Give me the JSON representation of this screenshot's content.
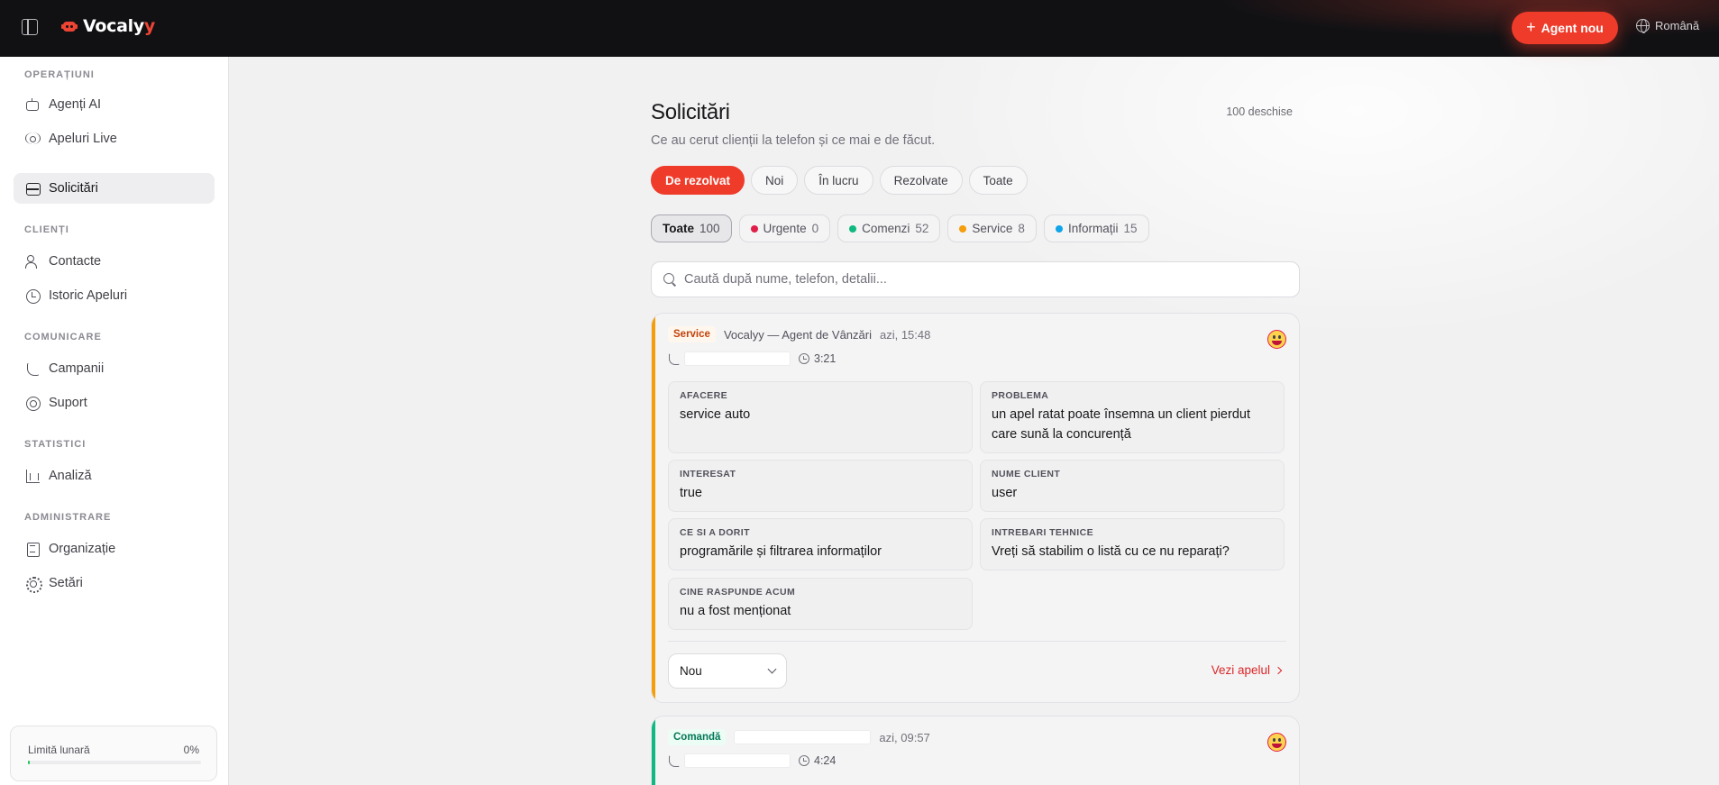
{
  "app": {
    "brand_main": "Vocaly",
    "brand_accent": "y",
    "new_agent_label": "Agent nou",
    "language": "Română",
    "colors": {
      "brand": "#ef4434",
      "sidebar_active": "#eeeef0"
    }
  },
  "sidebar": {
    "sections": [
      {
        "title": "OPERAȚIUNI",
        "items": [
          {
            "label": "Agenți AI",
            "icon": "robot-icon"
          },
          {
            "label": "Apeluri Live",
            "icon": "radio-icon"
          },
          {
            "label": "Solicitări",
            "icon": "inbox-icon",
            "active": true
          }
        ]
      },
      {
        "title": "CLIENȚI",
        "items": [
          {
            "label": "Contacte",
            "icon": "users-icon"
          },
          {
            "label": "Istoric Apeluri",
            "icon": "clock-icon"
          }
        ]
      },
      {
        "title": "COMUNICARE",
        "items": [
          {
            "label": "Campanii",
            "icon": "phone-outgoing-icon"
          },
          {
            "label": "Suport",
            "icon": "lifebuoy-icon"
          }
        ]
      },
      {
        "title": "STATISTICI",
        "items": [
          {
            "label": "Analiză",
            "icon": "bar-chart-icon"
          }
        ]
      },
      {
        "title": "ADMINISTRARE",
        "items": [
          {
            "label": "Organizație",
            "icon": "building-icon"
          },
          {
            "label": "Setări",
            "icon": "gear-icon"
          }
        ]
      }
    ],
    "limit": {
      "label": "Limită lunară",
      "value": "0%",
      "fraction": 0.0
    }
  },
  "page": {
    "title": "Solicitări",
    "subtitle": "Ce au cerut clienții la telefon și ce mai e de făcut.",
    "open_count": "100 deschise",
    "status_tabs": [
      {
        "label": "De rezolvat",
        "active": true
      },
      {
        "label": "Noi"
      },
      {
        "label": "În lucru"
      },
      {
        "label": "Rezolvate"
      },
      {
        "label": "Toate"
      }
    ],
    "category_tabs": [
      {
        "label": "Toate",
        "count": "100",
        "active": true,
        "color": ""
      },
      {
        "label": "Urgente",
        "count": "0",
        "color": "#e11d48"
      },
      {
        "label": "Comenzi",
        "count": "52",
        "color": "#10b981"
      },
      {
        "label": "Service",
        "count": "8",
        "color": "#f59e0b"
      },
      {
        "label": "Informații",
        "count": "15",
        "color": "#0ea5e9"
      }
    ],
    "search_placeholder": "Caută după nume, telefon, detalii..."
  },
  "cards": [
    {
      "category": "Service",
      "agent": "Vocalyy — Agent de Vânzări",
      "time": "azi, 15:48",
      "duration": "3:21",
      "fields": [
        {
          "label": "AFACERE",
          "value": "service auto"
        },
        {
          "label": "PROBLEMA",
          "value": "un apel ratat poate însemna un client pierdut care sună la concurență"
        },
        {
          "label": "INTERESAT",
          "value": "true"
        },
        {
          "label": "NUME CLIENT",
          "value": "user"
        },
        {
          "label": "CE SI A DORIT",
          "value": "programările și filtrarea informaților"
        },
        {
          "label": "INTREBARI TEHNICE",
          "value": "Vreți să stabilim o listă cu ce nu reparați?"
        },
        {
          "label": "CINE RASPUNDE ACUM",
          "value": "nu a fost menționat"
        }
      ],
      "status": "Nou",
      "view_call": "Vezi apelul"
    },
    {
      "category": "Comandă",
      "time": "azi, 09:57",
      "duration": "4:24"
    }
  ]
}
